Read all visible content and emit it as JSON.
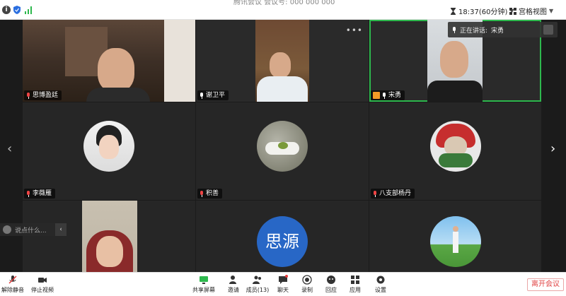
{
  "window": {
    "title": "腾讯会议 会议号: 000 000 000",
    "timer": "18:37(60分钟)",
    "view_label": "宫格视图"
  },
  "speaking_notice": {
    "prefix": "正在讲话:",
    "name": "宋勇"
  },
  "participants": [
    {
      "name": "思博盈廷",
      "muted": true
    },
    {
      "name": "谢卫平",
      "muted": false
    },
    {
      "name": "宋勇",
      "muted": false,
      "host": true
    },
    {
      "name": "李薇雁",
      "muted": true
    },
    {
      "name": "积善",
      "muted": true
    },
    {
      "name": "八支部杨丹",
      "muted": true
    },
    {
      "name": "",
      "muted": true
    },
    {
      "name": "思源",
      "avatar_text": "思源"
    },
    {
      "name": "",
      "muted": true
    }
  ],
  "chat": {
    "placeholder": "说点什么..."
  },
  "toolbar": {
    "unmute": "解除静音",
    "stop_video": "停止视频",
    "share": "共享屏幕",
    "invite": "邀请",
    "members": "成员(13)",
    "chat": "聊天",
    "record": "录制",
    "reactions": "回应",
    "apps": "应用",
    "settings": "设置",
    "leave": "离开会议"
  },
  "colors": {
    "active_border": "#2db84d",
    "leave_text": "#e14545",
    "avatar_blue": "#2867c6"
  }
}
